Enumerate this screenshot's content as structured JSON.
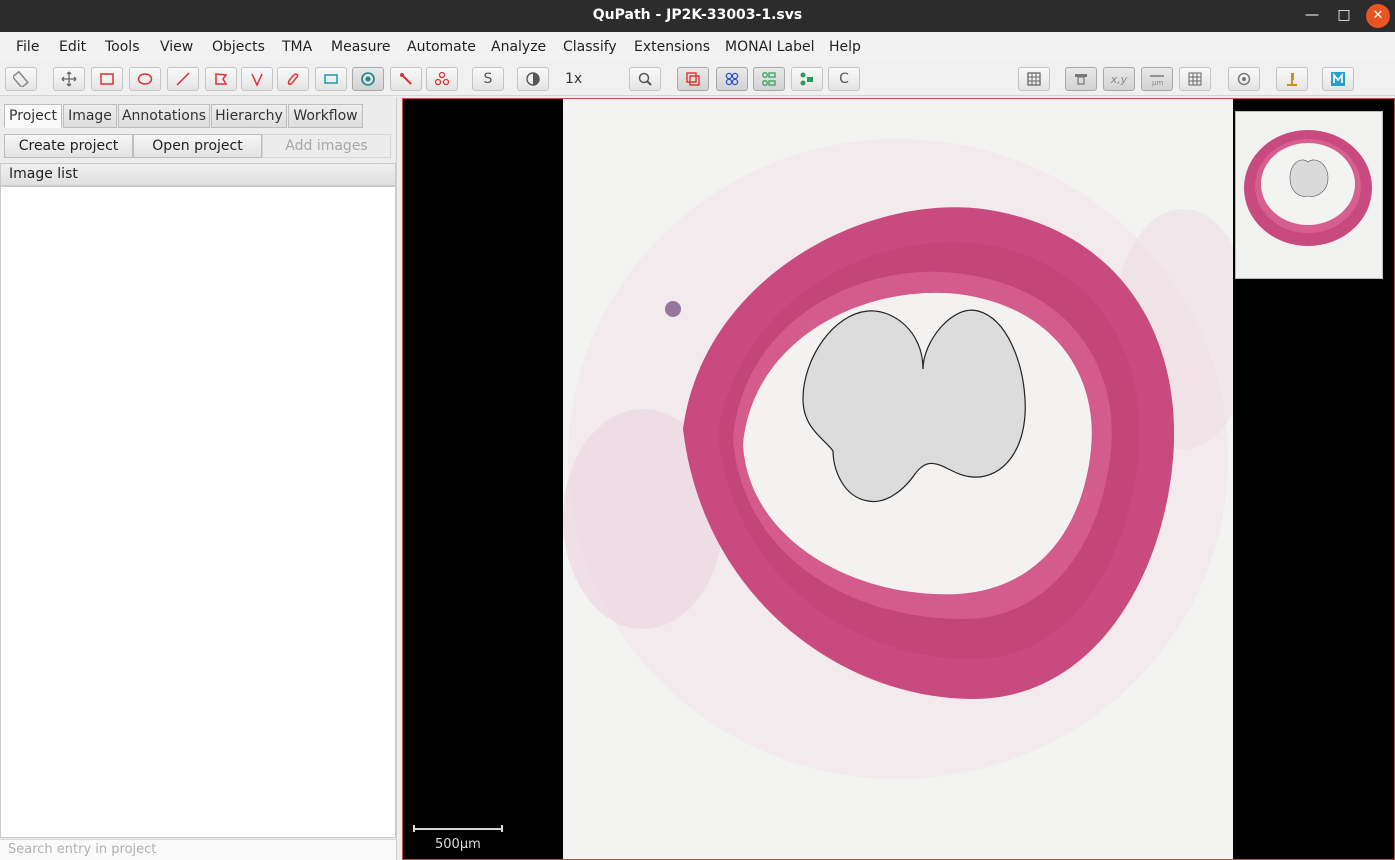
{
  "window": {
    "title": "QuPath - JP2K-33003-1.svs"
  },
  "menu": [
    "File",
    "Edit",
    "Tools",
    "View",
    "Objects",
    "TMA",
    "Measure",
    "Automate",
    "Analyze",
    "Classify",
    "Extensions",
    "MONAI Label",
    "Help"
  ],
  "toolbar": {
    "zoom_label": "1x",
    "brush_label": "S",
    "c_label": "C",
    "icons": [
      "measure-icon",
      "move-icon",
      "rectangle-icon",
      "ellipse-icon",
      "line-icon",
      "polygon-icon",
      "polyline-icon",
      "brush-icon",
      "points-icon",
      "wand-icon",
      "zoom-icon",
      "show-annotations-icon",
      "show-detections-icon",
      "fill-detections-icon",
      "grid-icon",
      "overview-icon",
      "location-icon",
      "scalebar-icon",
      "pixel-grid-icon",
      "preferences-icon",
      "microscope-icon",
      "monai-icon"
    ],
    "opacity_value": 0.95
  },
  "left_panel": {
    "tabs": [
      "Project",
      "Image",
      "Annotations",
      "Hierarchy",
      "Workflow"
    ],
    "active_tab": "Project",
    "buttons": {
      "create": "Create project",
      "open": "Open project",
      "add": "Add images"
    },
    "list_header": "Image list",
    "search_placeholder": "Search entry in project"
  },
  "viewer": {
    "scale_label": "500µm"
  },
  "colors": {
    "accent_close": "#e95420",
    "tissue_pink": "#c94a7e",
    "viewer_border": "#c24b4b"
  }
}
